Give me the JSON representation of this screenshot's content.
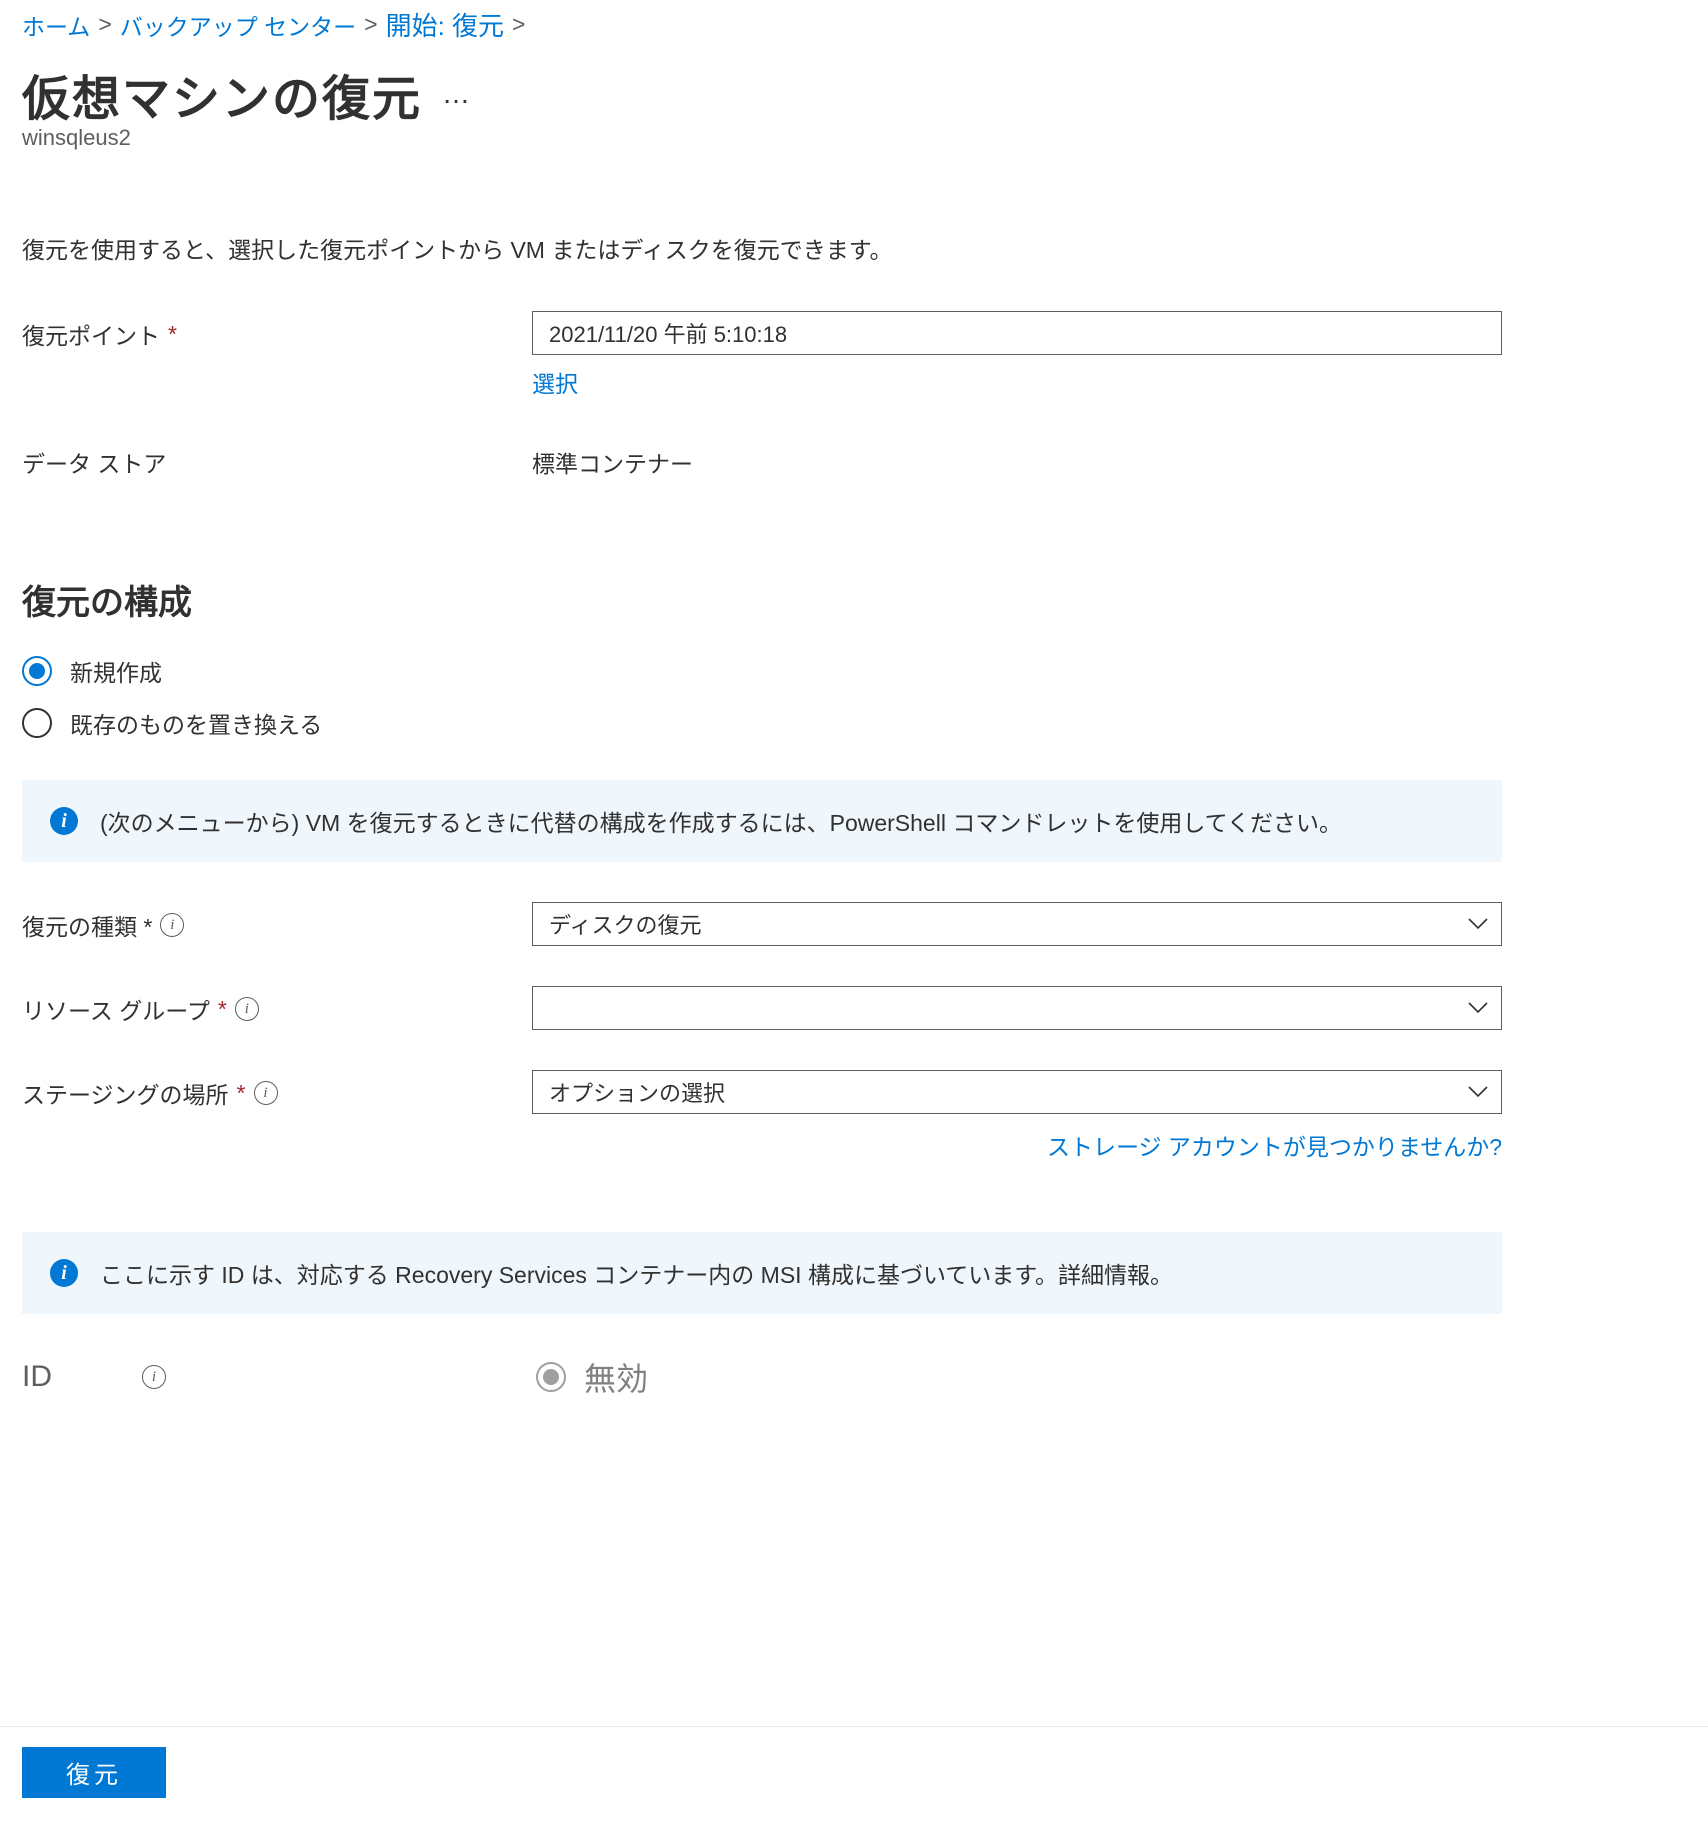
{
  "breadcrumb": {
    "home": "ホーム",
    "backup_center": "バックアップ センター",
    "start_restore": "開始: 復元"
  },
  "header": {
    "title": "仮想マシンの復元",
    "subtitle": "winsqleus2",
    "more": "…"
  },
  "description": "復元を使用すると、選択した復元ポイントから VM またはディスクを復元できます。",
  "form": {
    "restore_point_label": "復元ポイント",
    "restore_point_value": "2021/11/20 午前 5:10:18",
    "select_link": "選択",
    "data_store_label": "データ ストア",
    "data_store_value": "標準コンテナー"
  },
  "config": {
    "section_title": "復元の構成",
    "radio_new": "新規作成",
    "radio_replace": "既存のものを置き換える"
  },
  "info1": "(次のメニューから) VM を復元するときに代替の構成を作成するには、PowerShell コマンドレットを使用してください。",
  "fields": {
    "restore_type_label": "復元の種類 *",
    "restore_type_value": "ディスクの復元",
    "resource_group_label": "リソース グループ",
    "resource_group_value": "",
    "staging_label": "ステージングの場所",
    "staging_placeholder": "オプションの選択",
    "storage_link": "ストレージ アカウントが見つかりませんか?"
  },
  "info2": "ここに示す ID は、対応する Recovery Services コンテナー内の MSI 構成に基づいています。詳細情報。",
  "id_section": {
    "label": "ID",
    "value": "無効"
  },
  "footer": {
    "restore_button": "復元"
  }
}
